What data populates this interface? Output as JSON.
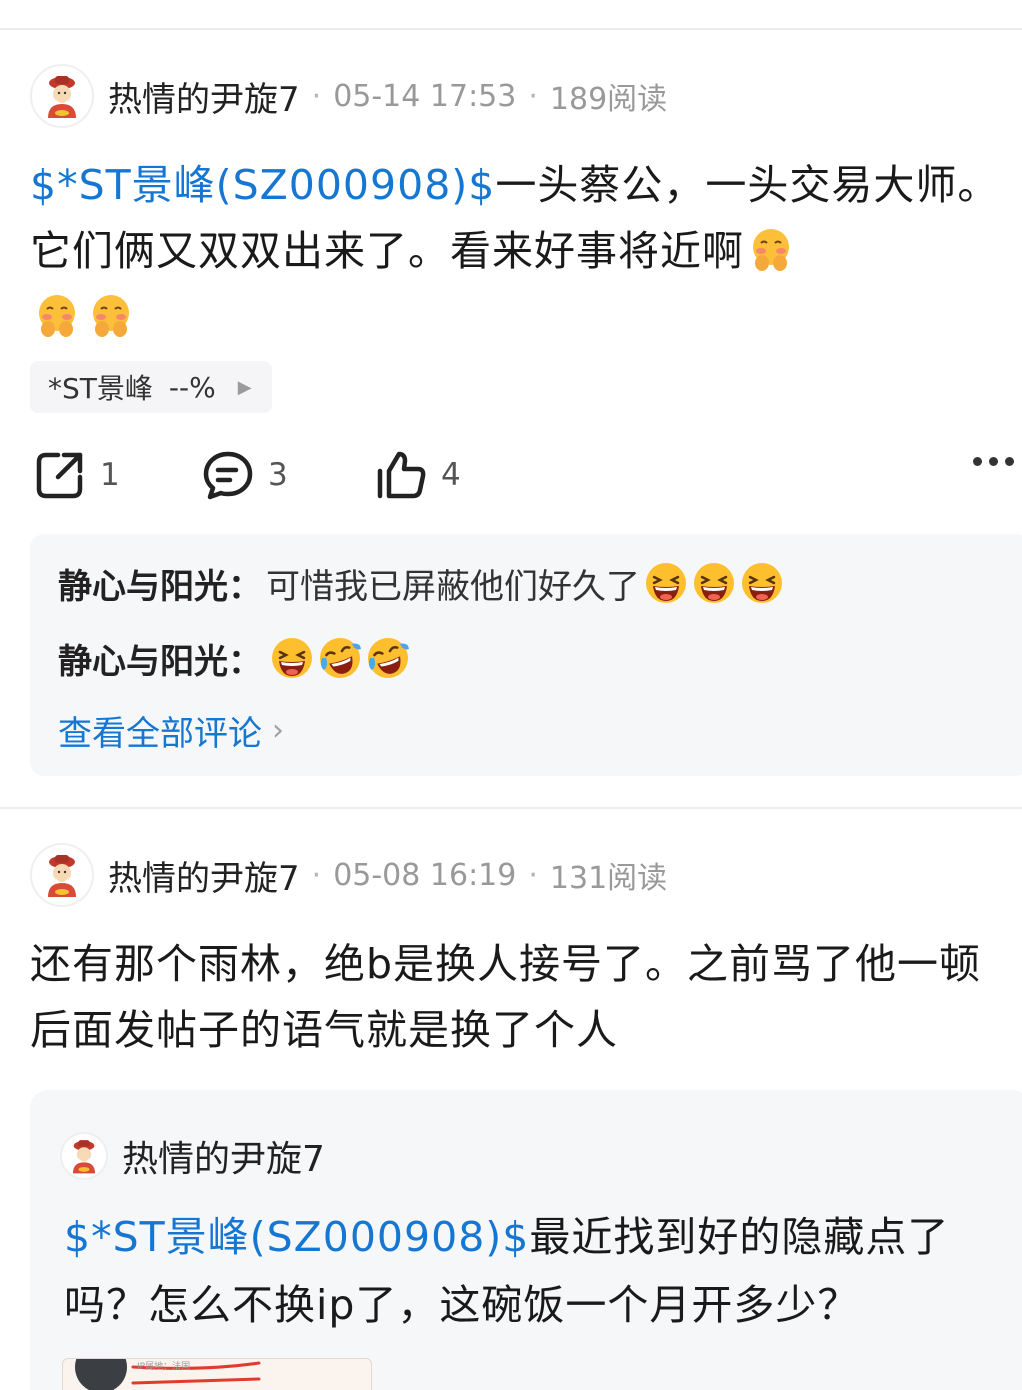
{
  "colors": {
    "accent_link": "#1677d2",
    "meta_gray": "#999999",
    "panel_bg": "#f6f7f9"
  },
  "posts": [
    {
      "author": "热情的尹旋7",
      "date": "05-14 17:53",
      "reads": "189阅读",
      "stock_tag": "$*ST景峰(SZ000908)$",
      "text": "一头蔡公，一头交易大师。它们俩又双双出来了。看来好事将近啊",
      "trailing_emojis": [
        "shy-giggle-emoji",
        "shy-giggle-emoji",
        "shy-giggle-emoji"
      ],
      "stock_chip": {
        "name": "*ST景峰",
        "change": "--%",
        "icon": "chevron-right-icon"
      },
      "actions": {
        "share_count": "1",
        "comment_count": "3",
        "like_count": "4",
        "share_icon": "share-icon",
        "comment_icon": "comment-icon",
        "like_icon": "thumbs-up-icon",
        "more_icon": "more-dots-icon"
      },
      "comments": [
        {
          "user": "静心与阳光：",
          "text": "可惜我已屏蔽他们好久了",
          "emojis": [
            "laughing-emoji",
            "laughing-emoji",
            "laughing-emoji"
          ]
        },
        {
          "user": "静心与阳光：",
          "text": "",
          "emojis": [
            "laughing-emoji",
            "laugh-crying-emoji",
            "laugh-crying-emoji"
          ]
        }
      ],
      "view_all_label": "查看全部评论"
    },
    {
      "author": "热情的尹旋7",
      "date": "05-08 16:19",
      "reads": "131阅读",
      "text": "还有那个雨林，绝b是换人接号了。之前骂了他一顿后面发帖子的语气就是换了个人",
      "quoted": {
        "author": "热情的尹旋7",
        "stock_tag": "$*ST景峰(SZ000908)$",
        "text": "最近找到好的隐藏点了吗？怎么不换ip了，这碗饭一个月开多少？",
        "thumb_caption": "IP属地：法国"
      }
    }
  ]
}
